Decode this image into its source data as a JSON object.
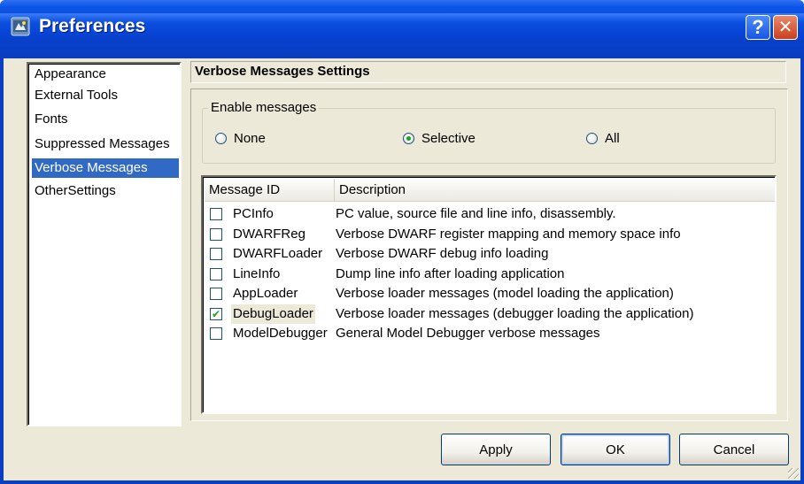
{
  "window": {
    "title": "Preferences",
    "help_button": "?",
    "close_button": "✕",
    "titlebar_color": "#0846d8"
  },
  "sidebar": {
    "items": [
      {
        "label": "Appearance"
      },
      {
        "label": "External Tools"
      },
      {
        "label": "Fonts"
      },
      {
        "label": "Suppressed Messages"
      },
      {
        "label": "Verbose Messages"
      },
      {
        "label": "OtherSettings"
      }
    ],
    "selected": "Verbose Messages",
    "selection_color": "#316ac5"
  },
  "section": {
    "title": "Verbose Messages Settings"
  },
  "enable_messages": {
    "legend": "Enable messages",
    "options": [
      {
        "label": "None",
        "checked": false
      },
      {
        "label": "Selective",
        "checked": true
      },
      {
        "label": "All",
        "checked": false
      }
    ]
  },
  "message_table": {
    "columns": [
      "Message ID",
      "Description"
    ],
    "rows": [
      {
        "id": "PCInfo",
        "description": "PC value, source file and line info, disassembly.",
        "checked": false
      },
      {
        "id": "DWARFReg",
        "description": "Verbose DWARF register mapping and memory space info",
        "checked": false
      },
      {
        "id": "DWARFLoader",
        "description": "Verbose DWARF debug info loading",
        "checked": false
      },
      {
        "id": "LineInfo",
        "description": "Dump line info after loading application",
        "checked": false
      },
      {
        "id": "AppLoader",
        "description": "Verbose loader messages (model loading the application)",
        "checked": false
      },
      {
        "id": "DebugLoader",
        "description": "Verbose loader messages (debugger loading the application)",
        "checked": true
      },
      {
        "id": "ModelDebugger",
        "description": "General Model Debugger verbose messages",
        "checked": false
      }
    ]
  },
  "buttons": {
    "apply": "Apply",
    "ok": "OK",
    "cancel": "Cancel"
  }
}
